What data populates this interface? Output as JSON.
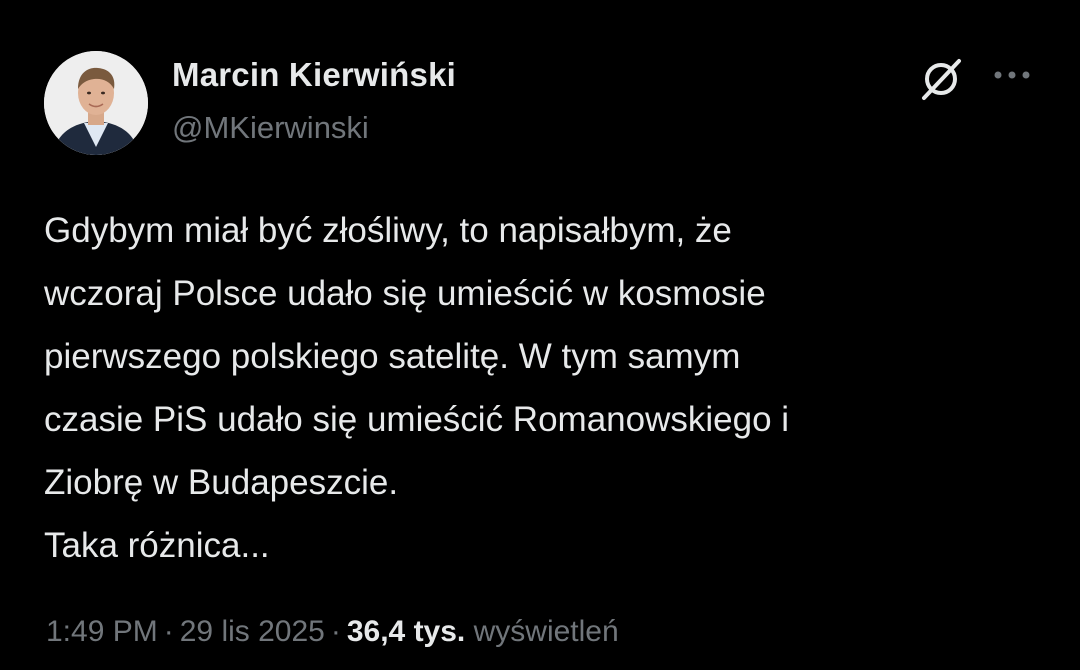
{
  "author": {
    "name": "Marcin Kierwiński",
    "handle": "@MKierwinski",
    "avatar_icon": "profile-photo"
  },
  "actions": {
    "grok_icon": "grok-icon",
    "more_icon": "more-dots-icon"
  },
  "tweet": {
    "lines": [
      "Gdybym miał być złośliwy, to napisałbym, że",
      "wczoraj Polsce udało się umieścić w kosmosie",
      "pierwszego polskiego satelitę. W tym samym",
      "czasie PiS udało się umieścić Romanowskiego i",
      "Ziobrę w Budapeszcie.",
      "Taka różnica..."
    ]
  },
  "meta": {
    "time": "1:49 PM",
    "separator": "·",
    "date": "29 lis 2025",
    "views_count": "36,4 tys.",
    "views_label": "wyświetleń"
  },
  "colors": {
    "background": "#000000",
    "primary_text": "#e7e9ea",
    "secondary_text": "#71767b"
  }
}
